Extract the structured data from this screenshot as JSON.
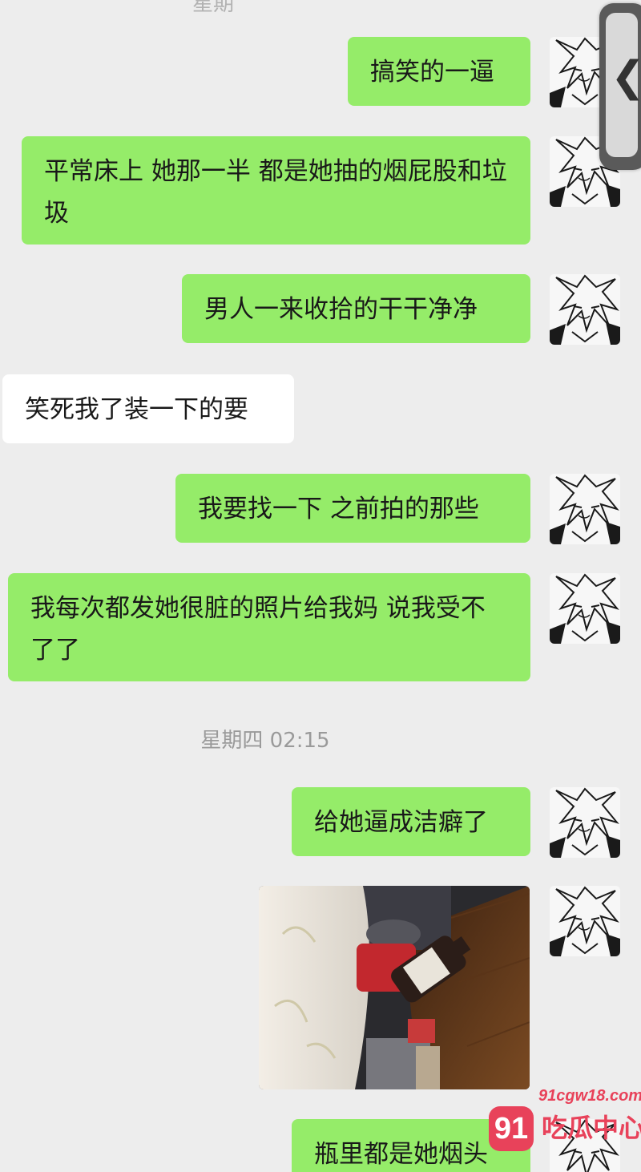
{
  "top_partial_timestamp": "星期",
  "messages": [
    {
      "side": "out",
      "text": "搞笑的一逼"
    },
    {
      "side": "out",
      "text": "平常床上 她那一半 都是她抽的烟屁股和垃圾"
    },
    {
      "side": "out",
      "text": "男人一来收拾的干干净净"
    },
    {
      "side": "in",
      "text": "笑死我了装一下的要"
    },
    {
      "side": "out",
      "text": "我要找一下 之前拍的那些"
    },
    {
      "side": "out",
      "text": "我每次都发她很脏的照片给我妈 说我受不了了"
    },
    {
      "side": "out",
      "text": "给她逼成洁癖了"
    },
    {
      "side": "out",
      "text": "瓶里都是她烟头"
    }
  ],
  "timestamp": "星期四 02:15",
  "photo": {
    "icon": "photo-thumbnail"
  },
  "side_handle": {
    "glyph": "❮"
  },
  "watermark": {
    "url": "91cgw18.com",
    "number": "91",
    "text": "吃瓜中心"
  },
  "colors": {
    "background": "#ededed",
    "outgoing_bubble": "#95ec69",
    "incoming_bubble": "#ffffff",
    "text": "#191919",
    "timestamp": "#9a9a9a",
    "watermark": "#e8425a"
  }
}
